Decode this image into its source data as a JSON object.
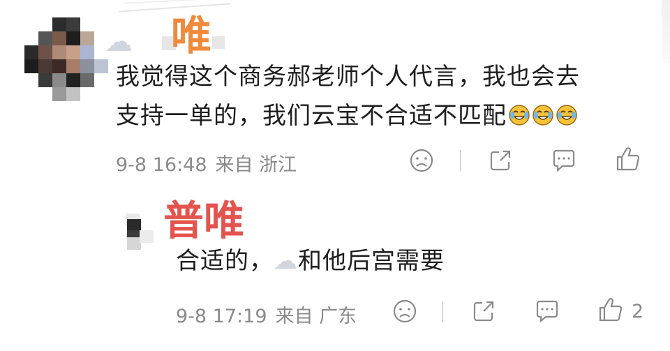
{
  "comment": {
    "username": "唯",
    "text_line1": "我觉得这个商务郝老师个人代言，我也会去",
    "text_line2": "支持一单的，我们云宝不合适不匹配",
    "emoji_name": "crying-laughing-emoji",
    "time": "9-8 16:48",
    "source": "来自 浙江"
  },
  "reply": {
    "username": "普唯",
    "text_a": "合适的，",
    "text_b": "和他后宫需要",
    "time": "9-8 17:19",
    "source": "来自 广东",
    "like_count": "2"
  },
  "colors": {
    "name_orange": "#f08a3c",
    "name_red": "#e4544e",
    "meta_grey": "#8a8a8a"
  },
  "icons": [
    "dislike-icon",
    "share-icon",
    "comment-icon",
    "like-icon"
  ]
}
